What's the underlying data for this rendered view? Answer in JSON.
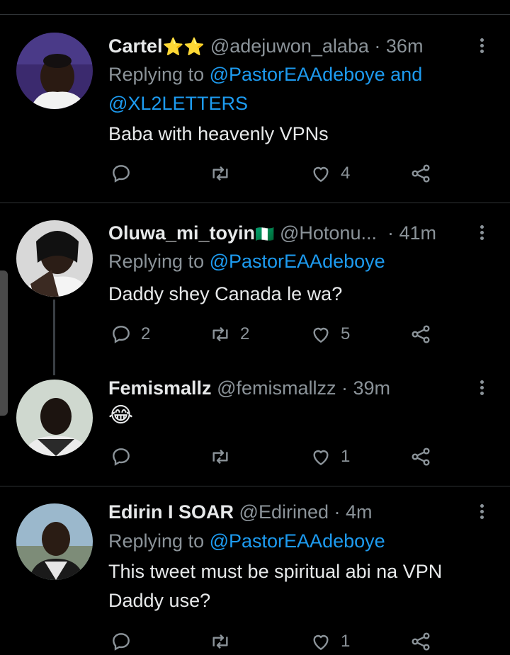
{
  "tweets": [
    {
      "name": "Cartel",
      "name_badge": "⭐⭐",
      "handle": "@adejuwon_alaba",
      "time": "· 36m",
      "replying_prefix": "Replying to ",
      "mentions_line1": "@PastorEAAdeboye",
      "mentions_join": " and",
      "mentions_line2": "@XL2LETTERS",
      "text": "Baba with heavenly VPNs",
      "replies": "",
      "retweets": "",
      "likes": "4"
    },
    {
      "name": "Oluwa_mi_toyin",
      "name_badge": "🇳🇬",
      "handle": "@Hotonu...",
      "time": "· 41m",
      "replying_prefix": "Replying to ",
      "mentions_line1": "@PastorEAAdeboye",
      "text": "Daddy shey Canada le wa?",
      "replies": "2",
      "retweets": "2",
      "likes": "5"
    },
    {
      "name": "Femismallz",
      "handle": "@femismallzz",
      "time": "· 39m",
      "text": "😂",
      "replies": "",
      "retweets": "",
      "likes": "1"
    },
    {
      "name": "Edirin I SOAR",
      "handle": "@Edirined",
      "time": "· 4m",
      "replying_prefix": "Replying to ",
      "mentions_line1": "@PastorEAAdeboye",
      "text_line1": "This tweet must be spiritual abi na VPN",
      "text_line2": "Daddy use?",
      "replies": "",
      "retweets": "",
      "likes": "1"
    }
  ],
  "icons": {
    "reply": "reply-icon",
    "retweet": "retweet-icon",
    "like": "heart-icon",
    "share": "share-icon",
    "more": "more-vertical-icon"
  },
  "colors": {
    "background": "#000000",
    "text": "#e7e9ea",
    "muted": "#8b9399",
    "link": "#1d9bf0",
    "divider": "#2f3336"
  }
}
